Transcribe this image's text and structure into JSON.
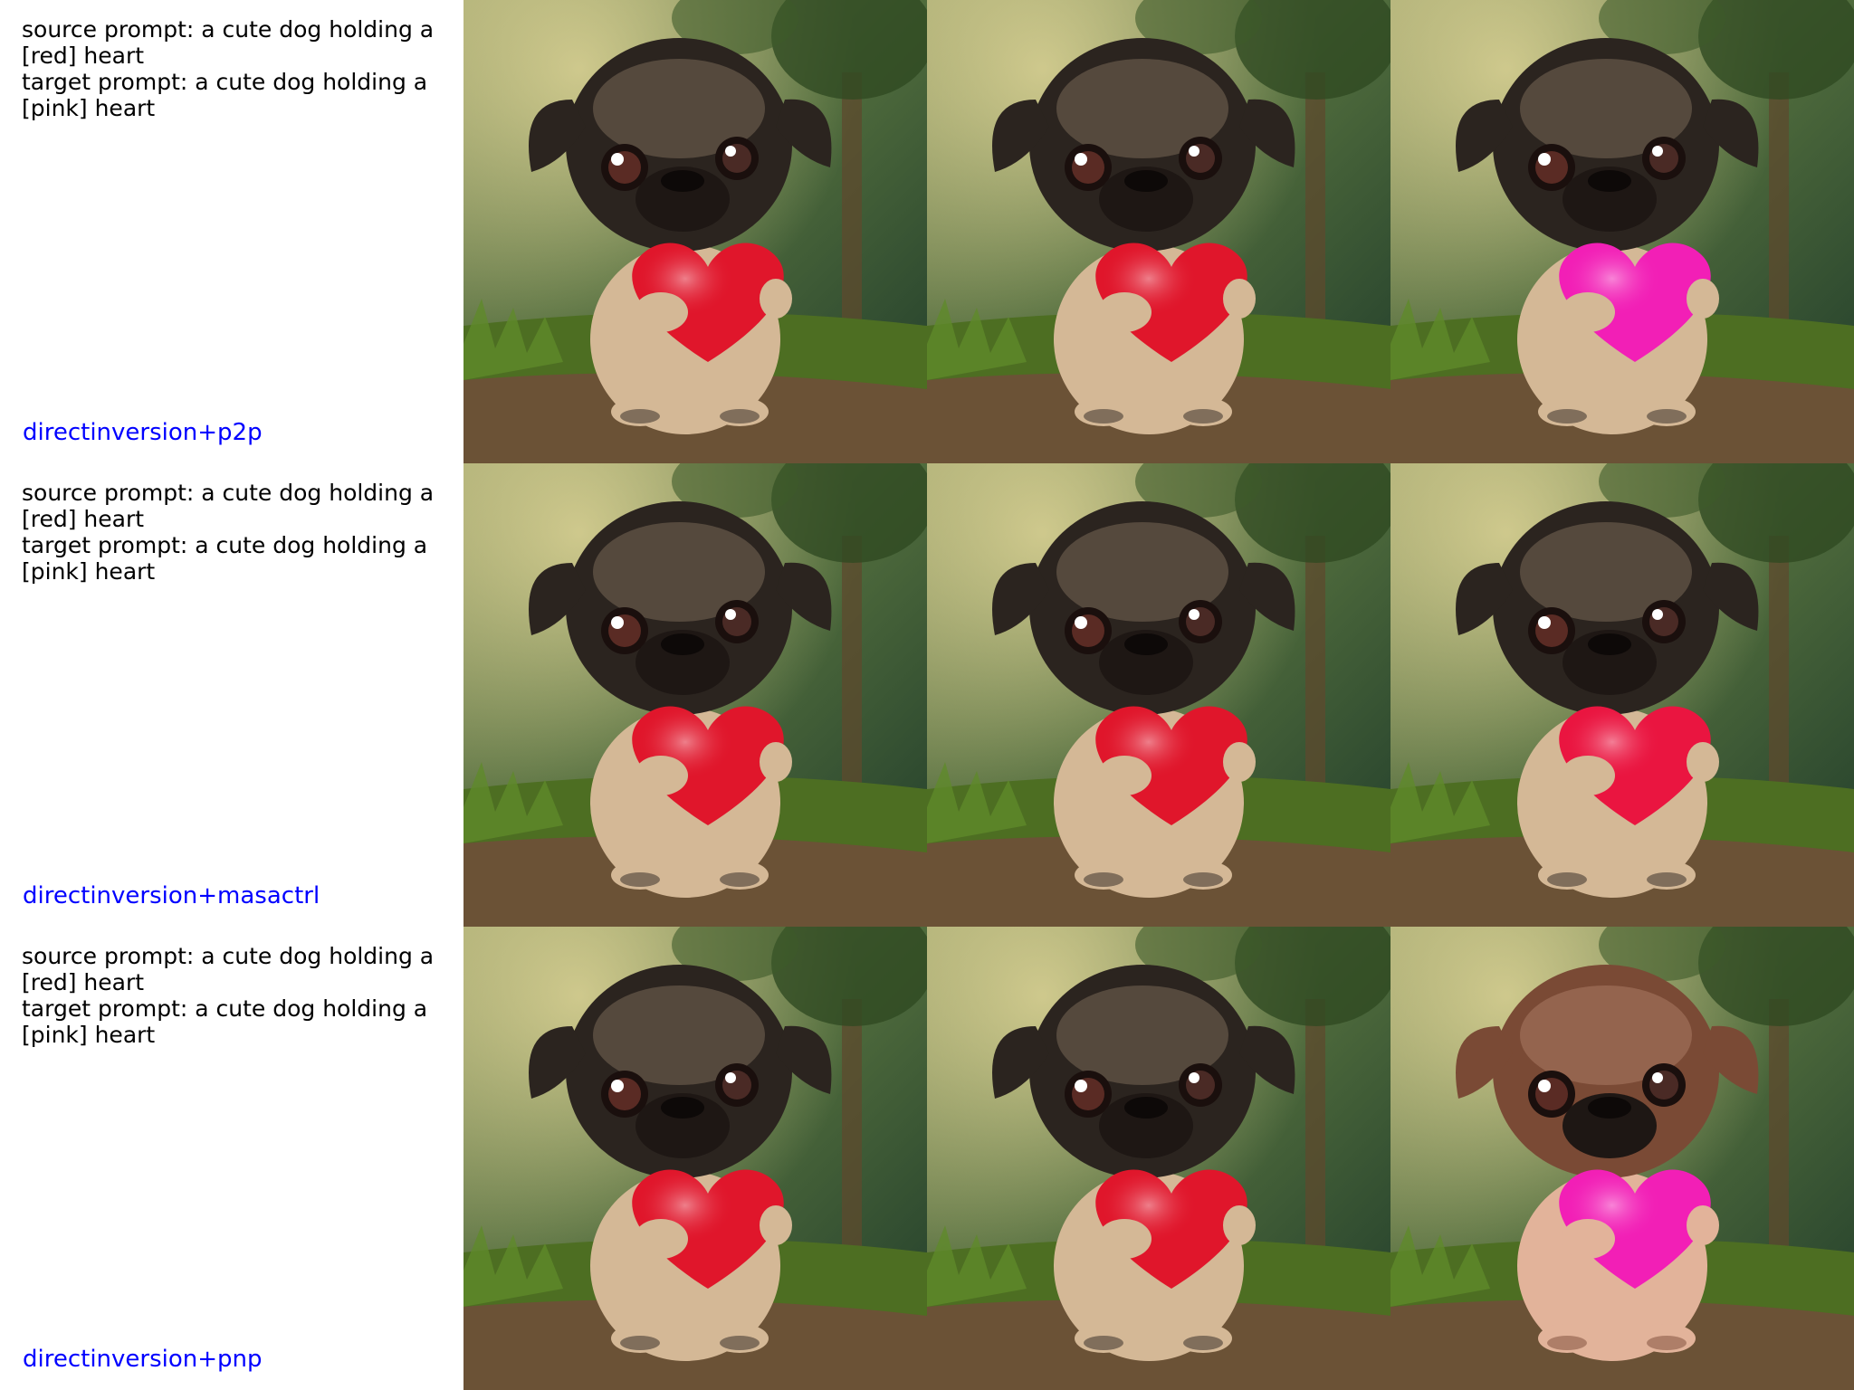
{
  "rows": [
    {
      "source_prompt": "source prompt: a cute dog holding a [red] heart",
      "target_prompt": "target prompt: a cute dog holding a [pink] heart",
      "method": "directinversion+p2p",
      "images": [
        {
          "alt": "pug holding red heart (source)",
          "dog": "#2b241f",
          "body": "#d4b896",
          "heart": "#e0162b"
        },
        {
          "alt": "pug holding red heart (reconstruction)",
          "dog": "#2b241f",
          "body": "#d4b896",
          "heart": "#e0162b"
        },
        {
          "alt": "pug holding pink heart (edited)",
          "dog": "#2b241f",
          "body": "#d4b896",
          "heart": "#f21fb6"
        }
      ]
    },
    {
      "source_prompt": "source prompt: a cute dog holding a [red] heart",
      "target_prompt": "target prompt: a cute dog holding a [pink] heart",
      "method": "directinversion+masactrl",
      "images": [
        {
          "alt": "pug holding red heart (source)",
          "dog": "#2b241f",
          "body": "#d4b896",
          "heart": "#e0162b"
        },
        {
          "alt": "pug holding red heart (reconstruction)",
          "dog": "#2b241f",
          "body": "#d4b896",
          "heart": "#e0162b"
        },
        {
          "alt": "pug holding red heart (edited)",
          "dog": "#2b241f",
          "body": "#d4b896",
          "heart": "#ea1540"
        }
      ]
    },
    {
      "source_prompt": "source prompt: a cute dog holding a [red] heart",
      "target_prompt": "target prompt: a cute dog holding a [pink] heart",
      "method": "directinversion+pnp",
      "images": [
        {
          "alt": "pug holding red heart (source)",
          "dog": "#2b241f",
          "body": "#d4b896",
          "heart": "#e0162b"
        },
        {
          "alt": "pug holding red heart (reconstruction)",
          "dog": "#2b241f",
          "body": "#d4b896",
          "heart": "#e0162b"
        },
        {
          "alt": "light brown pug holding pink heart (edited)",
          "dog": "#7a4a35",
          "body": "#e2b39a",
          "heart": "#f21fb6"
        }
      ]
    }
  ]
}
